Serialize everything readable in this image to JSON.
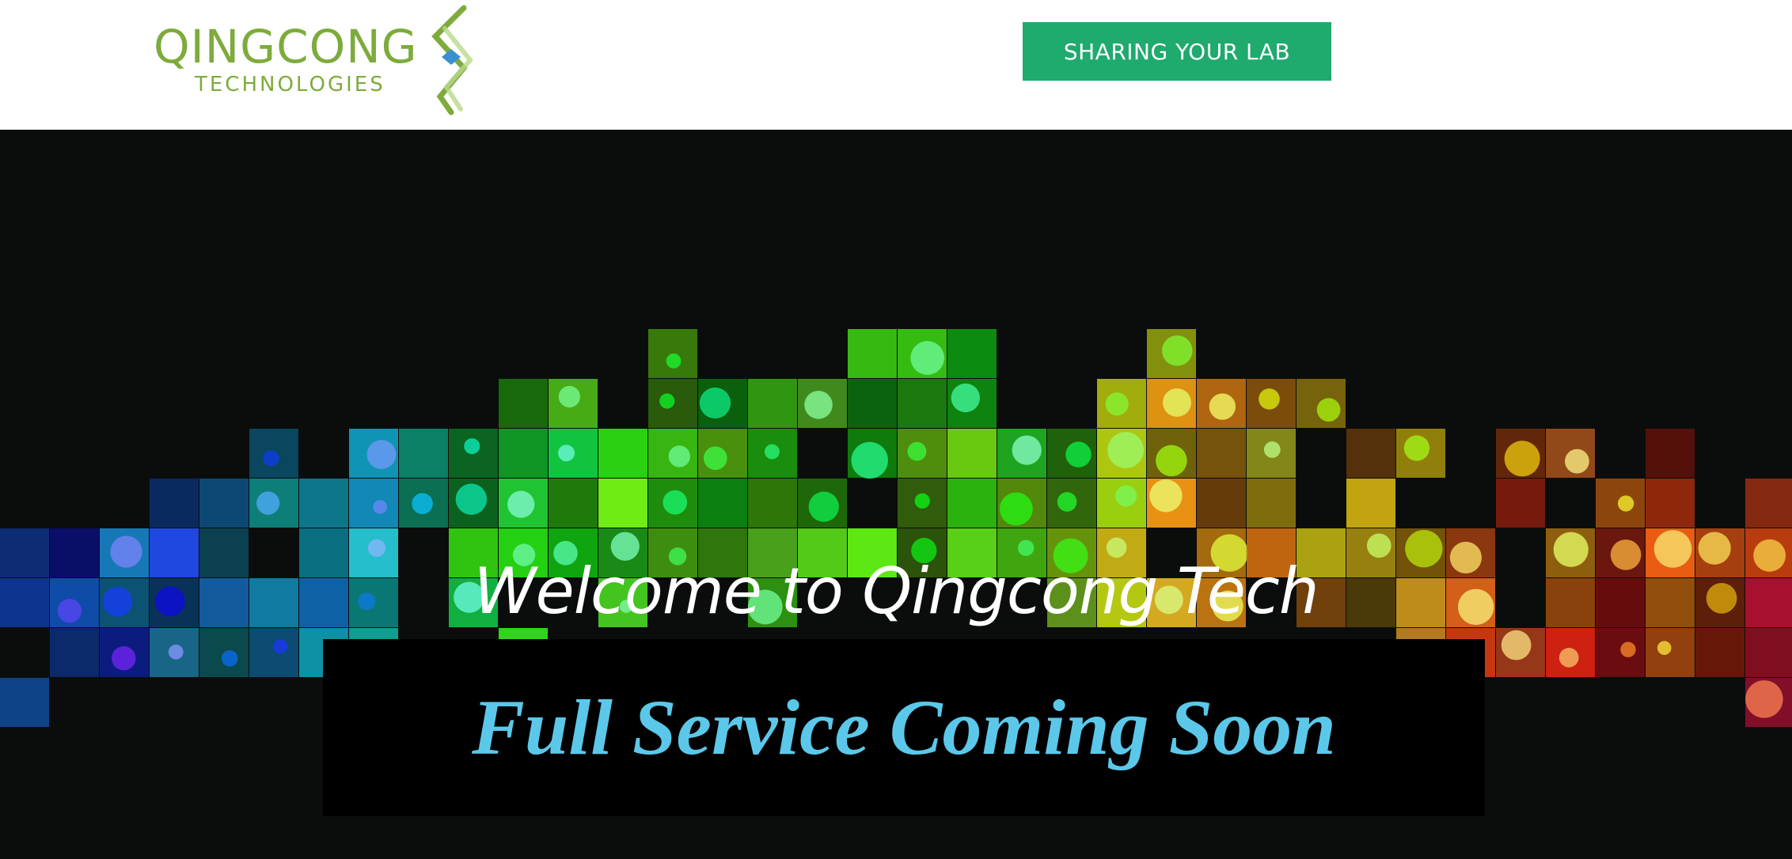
{
  "header": {
    "logo": {
      "name": "QINGCONG",
      "tagline": "TECHNOLOGIES",
      "icon": "dna-helix-icon",
      "color": "#7dab3c"
    },
    "cta_label": "SHARING YOUR LAB",
    "cta_color": "#1faa6e"
  },
  "hero": {
    "background_image": "fluorescence-microscopy-mosaic",
    "background_color": "#0b0d0c",
    "welcome": "Welcome to Qingcong Tech",
    "notice": "Full Service Coming Soon",
    "notice_color": "#5bc8ea"
  }
}
